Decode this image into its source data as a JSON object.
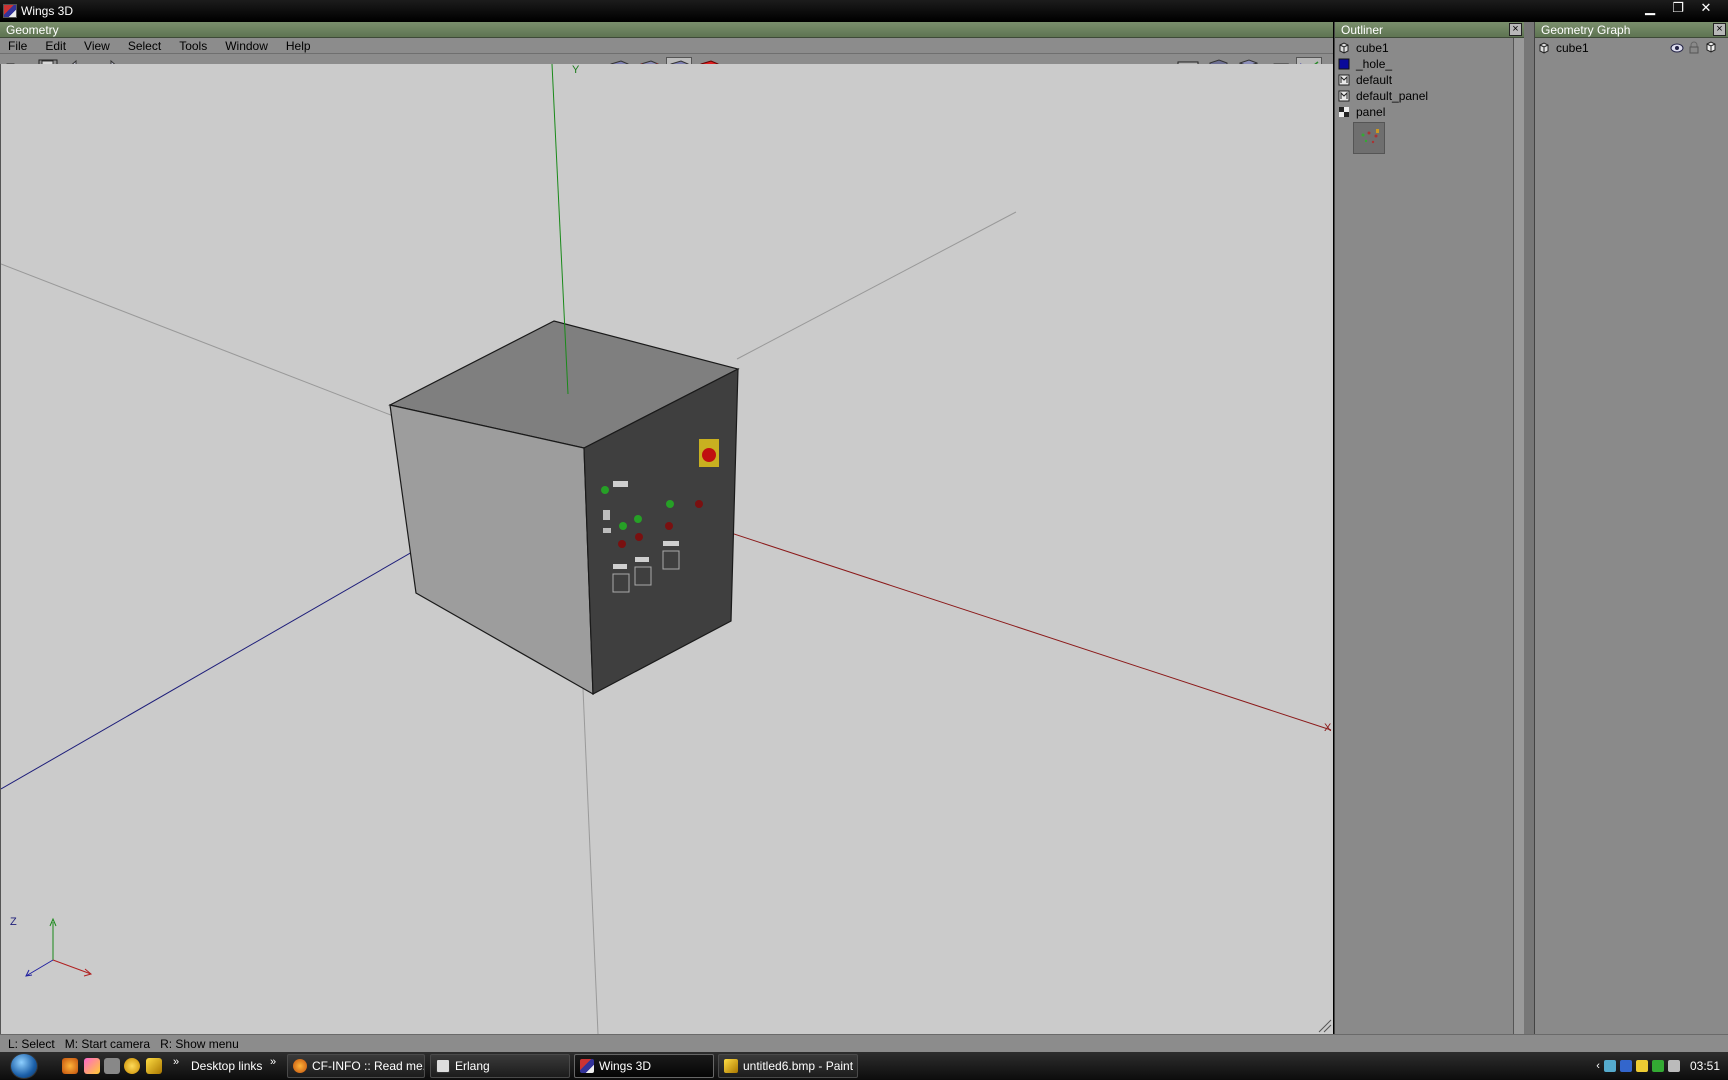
{
  "window": {
    "title": "Wings 3D"
  },
  "geometry": {
    "header": "Geometry",
    "menu": [
      "File",
      "Edit",
      "View",
      "Select",
      "Tools",
      "Window",
      "Help"
    ],
    "axes": {
      "y": "Y",
      "x": "X",
      "z": "Z"
    }
  },
  "outliner": {
    "header": "Outliner",
    "items": [
      {
        "label": "cube1",
        "icon": "cube-icon"
      },
      {
        "label": "_hole_",
        "icon": "material-swatch-icon",
        "color": "#0a0a9a"
      },
      {
        "label": "default",
        "icon": "material-icon"
      },
      {
        "label": "default_panel",
        "icon": "material-icon"
      },
      {
        "label": "panel",
        "icon": "image-icon"
      }
    ]
  },
  "geometry_graph": {
    "header": "Geometry Graph",
    "items": [
      {
        "label": "cube1",
        "icon": "cube-icon"
      }
    ]
  },
  "status": {
    "left": "L: Select",
    "middle": "M: Start camera",
    "right": "R: Show menu"
  },
  "taskbar": {
    "desktop_links": "Desktop links",
    "tasks": [
      {
        "label": "CF-INFO :: Read me...",
        "active": false
      },
      {
        "label": "Erlang",
        "active": false
      },
      {
        "label": "Wings 3D",
        "active": true
      },
      {
        "label": "untitled6.bmp - Paint",
        "active": false
      }
    ],
    "clock": "03:51"
  },
  "colors": {
    "viewport": "#cbcbcb",
    "header": "#6a8060",
    "x_axis": "#8b0000",
    "y_axis": "#008000",
    "z_axis": "#00008b"
  }
}
